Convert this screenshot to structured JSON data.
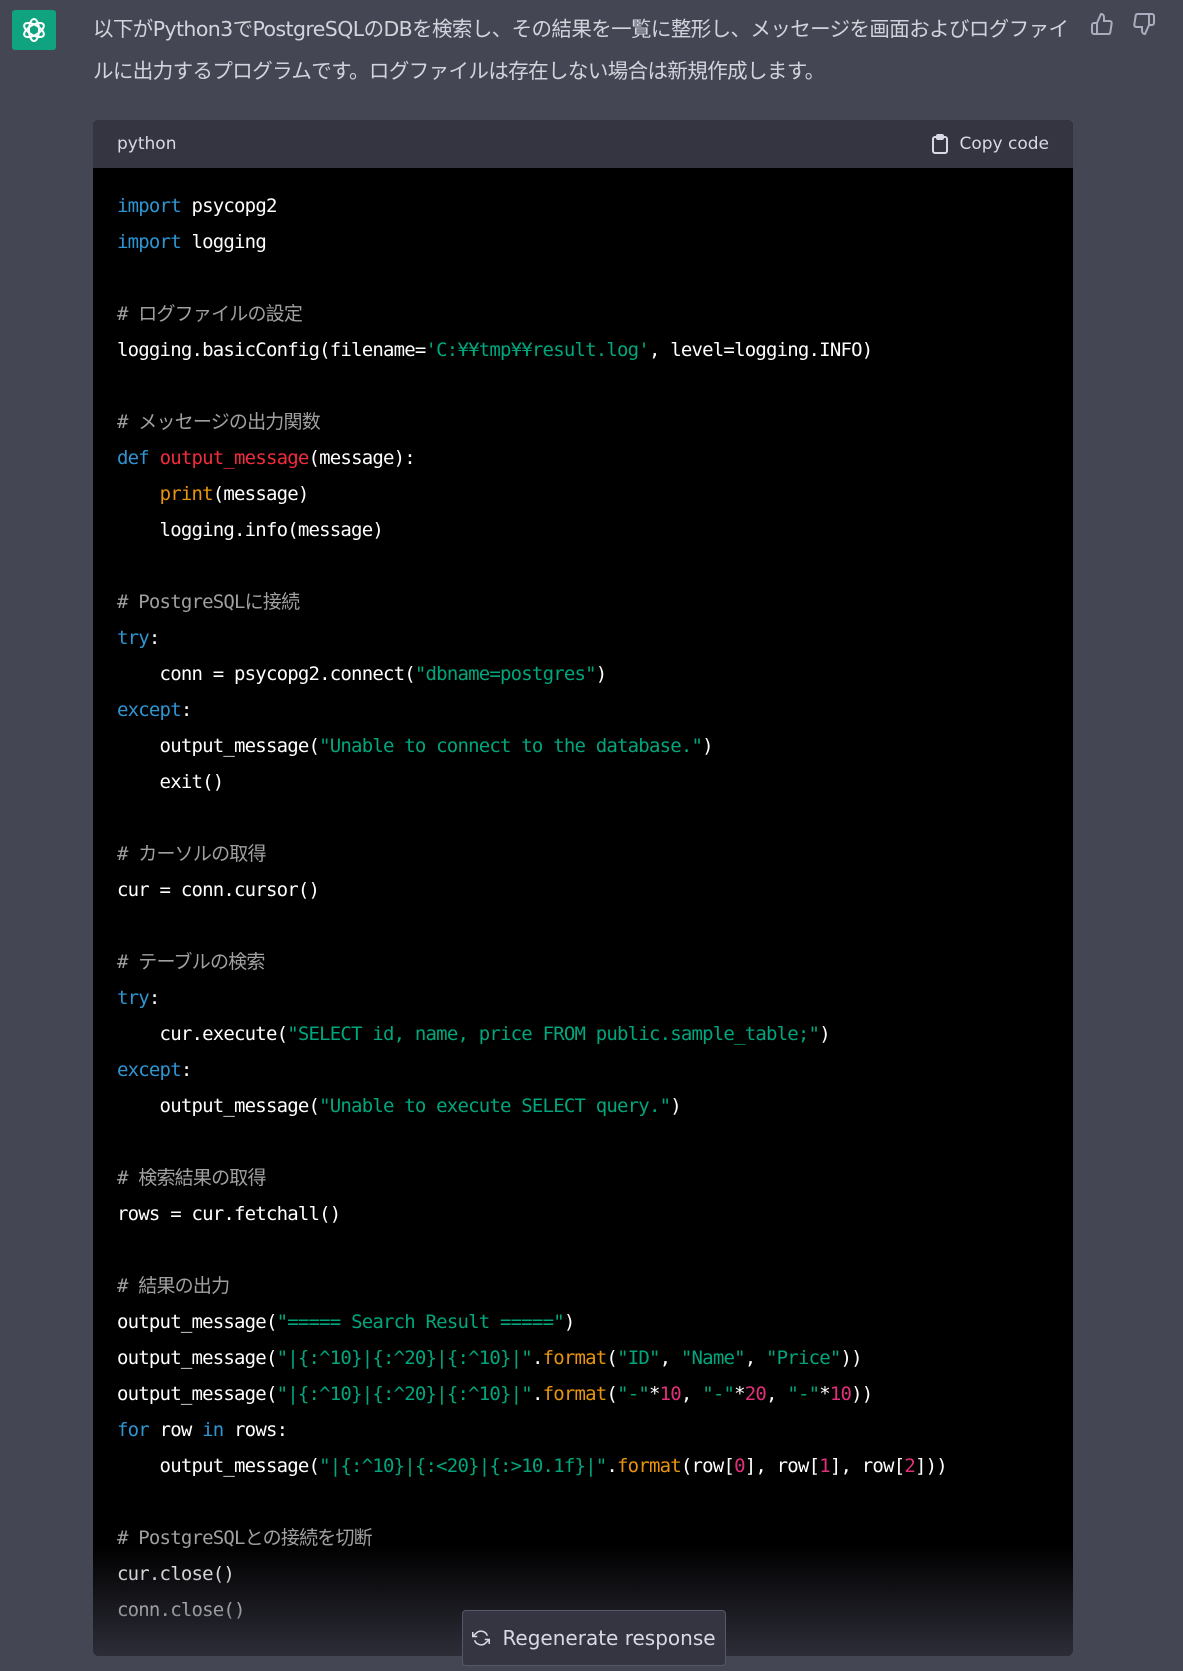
{
  "assistant": {
    "avatar_icon": "openai-logo-icon",
    "accent": "#10a37f"
  },
  "message": {
    "intro": "以下がPython3でPostgreSQLのDBを検索し、その結果を一覧に整形し、メッセージを画面およびログファイルに出力するプログラムです。ログファイルは存在しない場合は新規作成します。"
  },
  "feedback": {
    "thumbs_up_icon": "thumbs-up-icon",
    "thumbs_down_icon": "thumbs-down-icon"
  },
  "code_block": {
    "language": "python",
    "copy_label": "Copy code",
    "lines": [
      [
        [
          "kw",
          "import"
        ],
        [
          "",
          "psycopg2"
        ]
      ],
      [
        [
          "kw",
          "import"
        ],
        [
          "",
          "logging"
        ]
      ],
      [],
      [
        [
          "cm",
          "# ログファイルの設定"
        ]
      ],
      [
        [
          "",
          "logging.basicConfig(filename="
        ],
        [
          "str",
          "'C:¥¥tmp¥¥result.log'"
        ],
        [
          "",
          ", level=logging.INFO)"
        ]
      ],
      [],
      [
        [
          "cm",
          "# メッセージの出力関数"
        ]
      ],
      [
        [
          "kw",
          "def"
        ],
        [
          "fn",
          "output_message"
        ],
        [
          "",
          "(message):"
        ]
      ],
      [
        [
          "",
          "    "
        ],
        [
          "bi",
          "print"
        ],
        [
          "",
          "(message)"
        ]
      ],
      [
        [
          "",
          "    logging.info(message)"
        ]
      ],
      [],
      [
        [
          "cm",
          "# PostgreSQLに接続"
        ]
      ],
      [
        [
          "kw",
          "try"
        ],
        [
          "",
          ":"
        ]
      ],
      [
        [
          "",
          "    conn = psycopg2.connect("
        ],
        [
          "str",
          "\"dbname=postgres\""
        ],
        [
          "",
          ")"
        ]
      ],
      [
        [
          "kw",
          "except"
        ],
        [
          "",
          ":"
        ]
      ],
      [
        [
          "",
          "    output_message("
        ],
        [
          "str",
          "\"Unable to connect to the database.\""
        ],
        [
          "",
          ")"
        ]
      ],
      [
        [
          "",
          "    exit()"
        ]
      ],
      [],
      [
        [
          "cm",
          "# カーソルの取得"
        ]
      ],
      [
        [
          "",
          "cur = conn.cursor()"
        ]
      ],
      [],
      [
        [
          "cm",
          "# テーブルの検索"
        ]
      ],
      [
        [
          "kw",
          "try"
        ],
        [
          "",
          ":"
        ]
      ],
      [
        [
          "",
          "    cur.execute("
        ],
        [
          "str",
          "\"SELECT id, name, price FROM public.sample_table;\""
        ],
        [
          "",
          ")"
        ]
      ],
      [
        [
          "kw",
          "except"
        ],
        [
          "",
          ":"
        ]
      ],
      [
        [
          "",
          "    output_message("
        ],
        [
          "str",
          "\"Unable to execute SELECT query.\""
        ],
        [
          "",
          ")"
        ]
      ],
      [],
      [
        [
          "cm",
          "# 検索結果の取得"
        ]
      ],
      [
        [
          "",
          "rows = cur.fetchall()"
        ]
      ],
      [],
      [
        [
          "cm",
          "# 結果の出力"
        ]
      ],
      [
        [
          "",
          "output_message("
        ],
        [
          "str",
          "\"===== Search Result =====\""
        ],
        [
          "",
          ")"
        ]
      ],
      [
        [
          "",
          "output_message("
        ],
        [
          "str",
          "\"|{:^10}|{:^20}|{:^10}|\""
        ],
        [
          "",
          "."
        ],
        [
          "bi",
          "format"
        ],
        [
          "",
          "("
        ],
        [
          "str",
          "\"ID\""
        ],
        [
          "",
          ", "
        ],
        [
          "str",
          "\"Name\""
        ],
        [
          "",
          ", "
        ],
        [
          "str",
          "\"Price\""
        ],
        [
          "",
          "))"
        ]
      ],
      [
        [
          "",
          "output_message("
        ],
        [
          "str",
          "\"|{:^10}|{:^20}|{:^10}|\""
        ],
        [
          "",
          "."
        ],
        [
          "bi",
          "format"
        ],
        [
          "",
          "("
        ],
        [
          "str",
          "\"-\""
        ],
        [
          "",
          "*"
        ],
        [
          "num",
          "10"
        ],
        [
          "",
          ", "
        ],
        [
          "str",
          "\"-\""
        ],
        [
          "",
          "*"
        ],
        [
          "num",
          "20"
        ],
        [
          "",
          ", "
        ],
        [
          "str",
          "\"-\""
        ],
        [
          "",
          "*"
        ],
        [
          "num",
          "10"
        ],
        [
          "",
          "))"
        ]
      ],
      [
        [
          "kw",
          "for"
        ],
        [
          "",
          "row "
        ],
        [
          "kw",
          "in"
        ],
        [
          "",
          "rows:"
        ]
      ],
      [
        [
          "",
          "    output_message("
        ],
        [
          "str",
          "\"|{:^10}|{:<20}|{:>10.1f}|\""
        ],
        [
          "",
          "."
        ],
        [
          "bi",
          "format"
        ],
        [
          "",
          "(row["
        ],
        [
          "num",
          "0"
        ],
        [
          "",
          "], row["
        ],
        [
          "num",
          "1"
        ],
        [
          "",
          "], row["
        ],
        [
          "num",
          "2"
        ],
        [
          "",
          "]))"
        ]
      ],
      [],
      [
        [
          "cm",
          "# PostgreSQLとの接続を切断"
        ]
      ],
      [
        [
          "",
          "cur.close()"
        ]
      ],
      [
        [
          "",
          "conn.close()"
        ]
      ]
    ]
  },
  "regenerate": {
    "label": "Regenerate response",
    "icon": "refresh-icon"
  }
}
